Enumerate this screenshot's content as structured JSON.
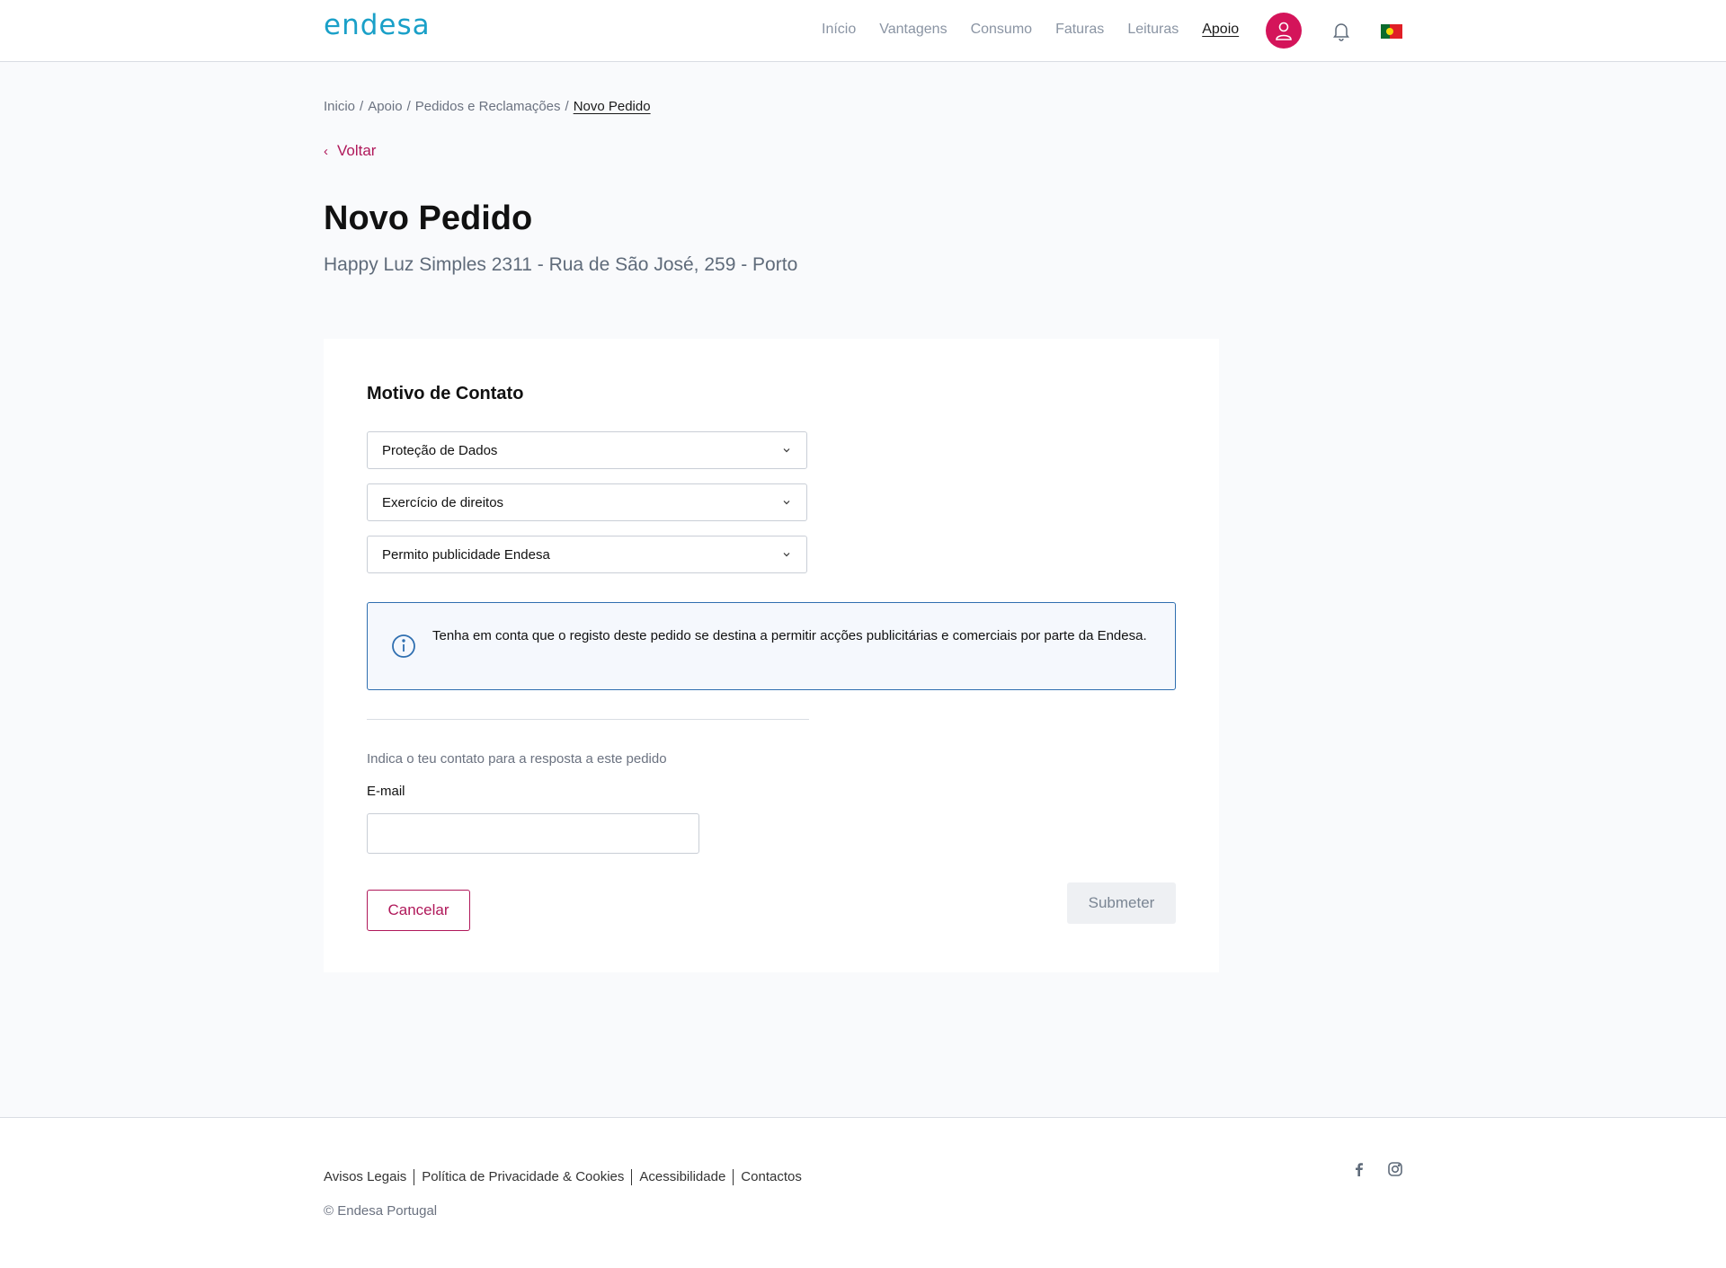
{
  "header": {
    "logo": "endesa",
    "nav": [
      "Início",
      "Vantagens",
      "Consumo",
      "Faturas",
      "Leituras",
      "Apoio"
    ],
    "active_nav": "Apoio"
  },
  "breadcrumb": [
    "Inicio",
    "Apoio",
    "Pedidos e Reclamações",
    "Novo Pedido"
  ],
  "back_label": "Voltar",
  "page": {
    "title": "Novo Pedido",
    "subtitle": "Happy Luz Simples 2311 - Rua de São José, 259 - Porto"
  },
  "form": {
    "section_title": "Motivo de Contato",
    "selects": [
      "Proteção de Dados",
      "Exercício de direitos",
      "Permito publicidade Endesa"
    ],
    "info_text": "Tenha em conta que o registo deste pedido se destina a permitir acções publicitárias e comerciais por parte da Endesa.",
    "contact_hint": "Indica o teu contato para a resposta a este pedido",
    "email_label": "E-mail",
    "email_value": "",
    "cancel_label": "Cancelar",
    "submit_label": "Submeter"
  },
  "footer": {
    "links": [
      "Avisos Legais",
      "Política de Privacidade & Cookies",
      "Acessibilidade",
      "Contactos"
    ],
    "copyright": "© Endesa Portugal"
  },
  "colors": {
    "brand": "#d4145a",
    "link_accent": "#b0185a",
    "info_border": "#2f6fb0",
    "logo": "#1aa0c8"
  },
  "icons": [
    "user-icon",
    "bell-icon",
    "portugal-flag-icon",
    "chevron-left-icon",
    "chevron-down-icon",
    "info-icon",
    "facebook-icon",
    "instagram-icon"
  ]
}
